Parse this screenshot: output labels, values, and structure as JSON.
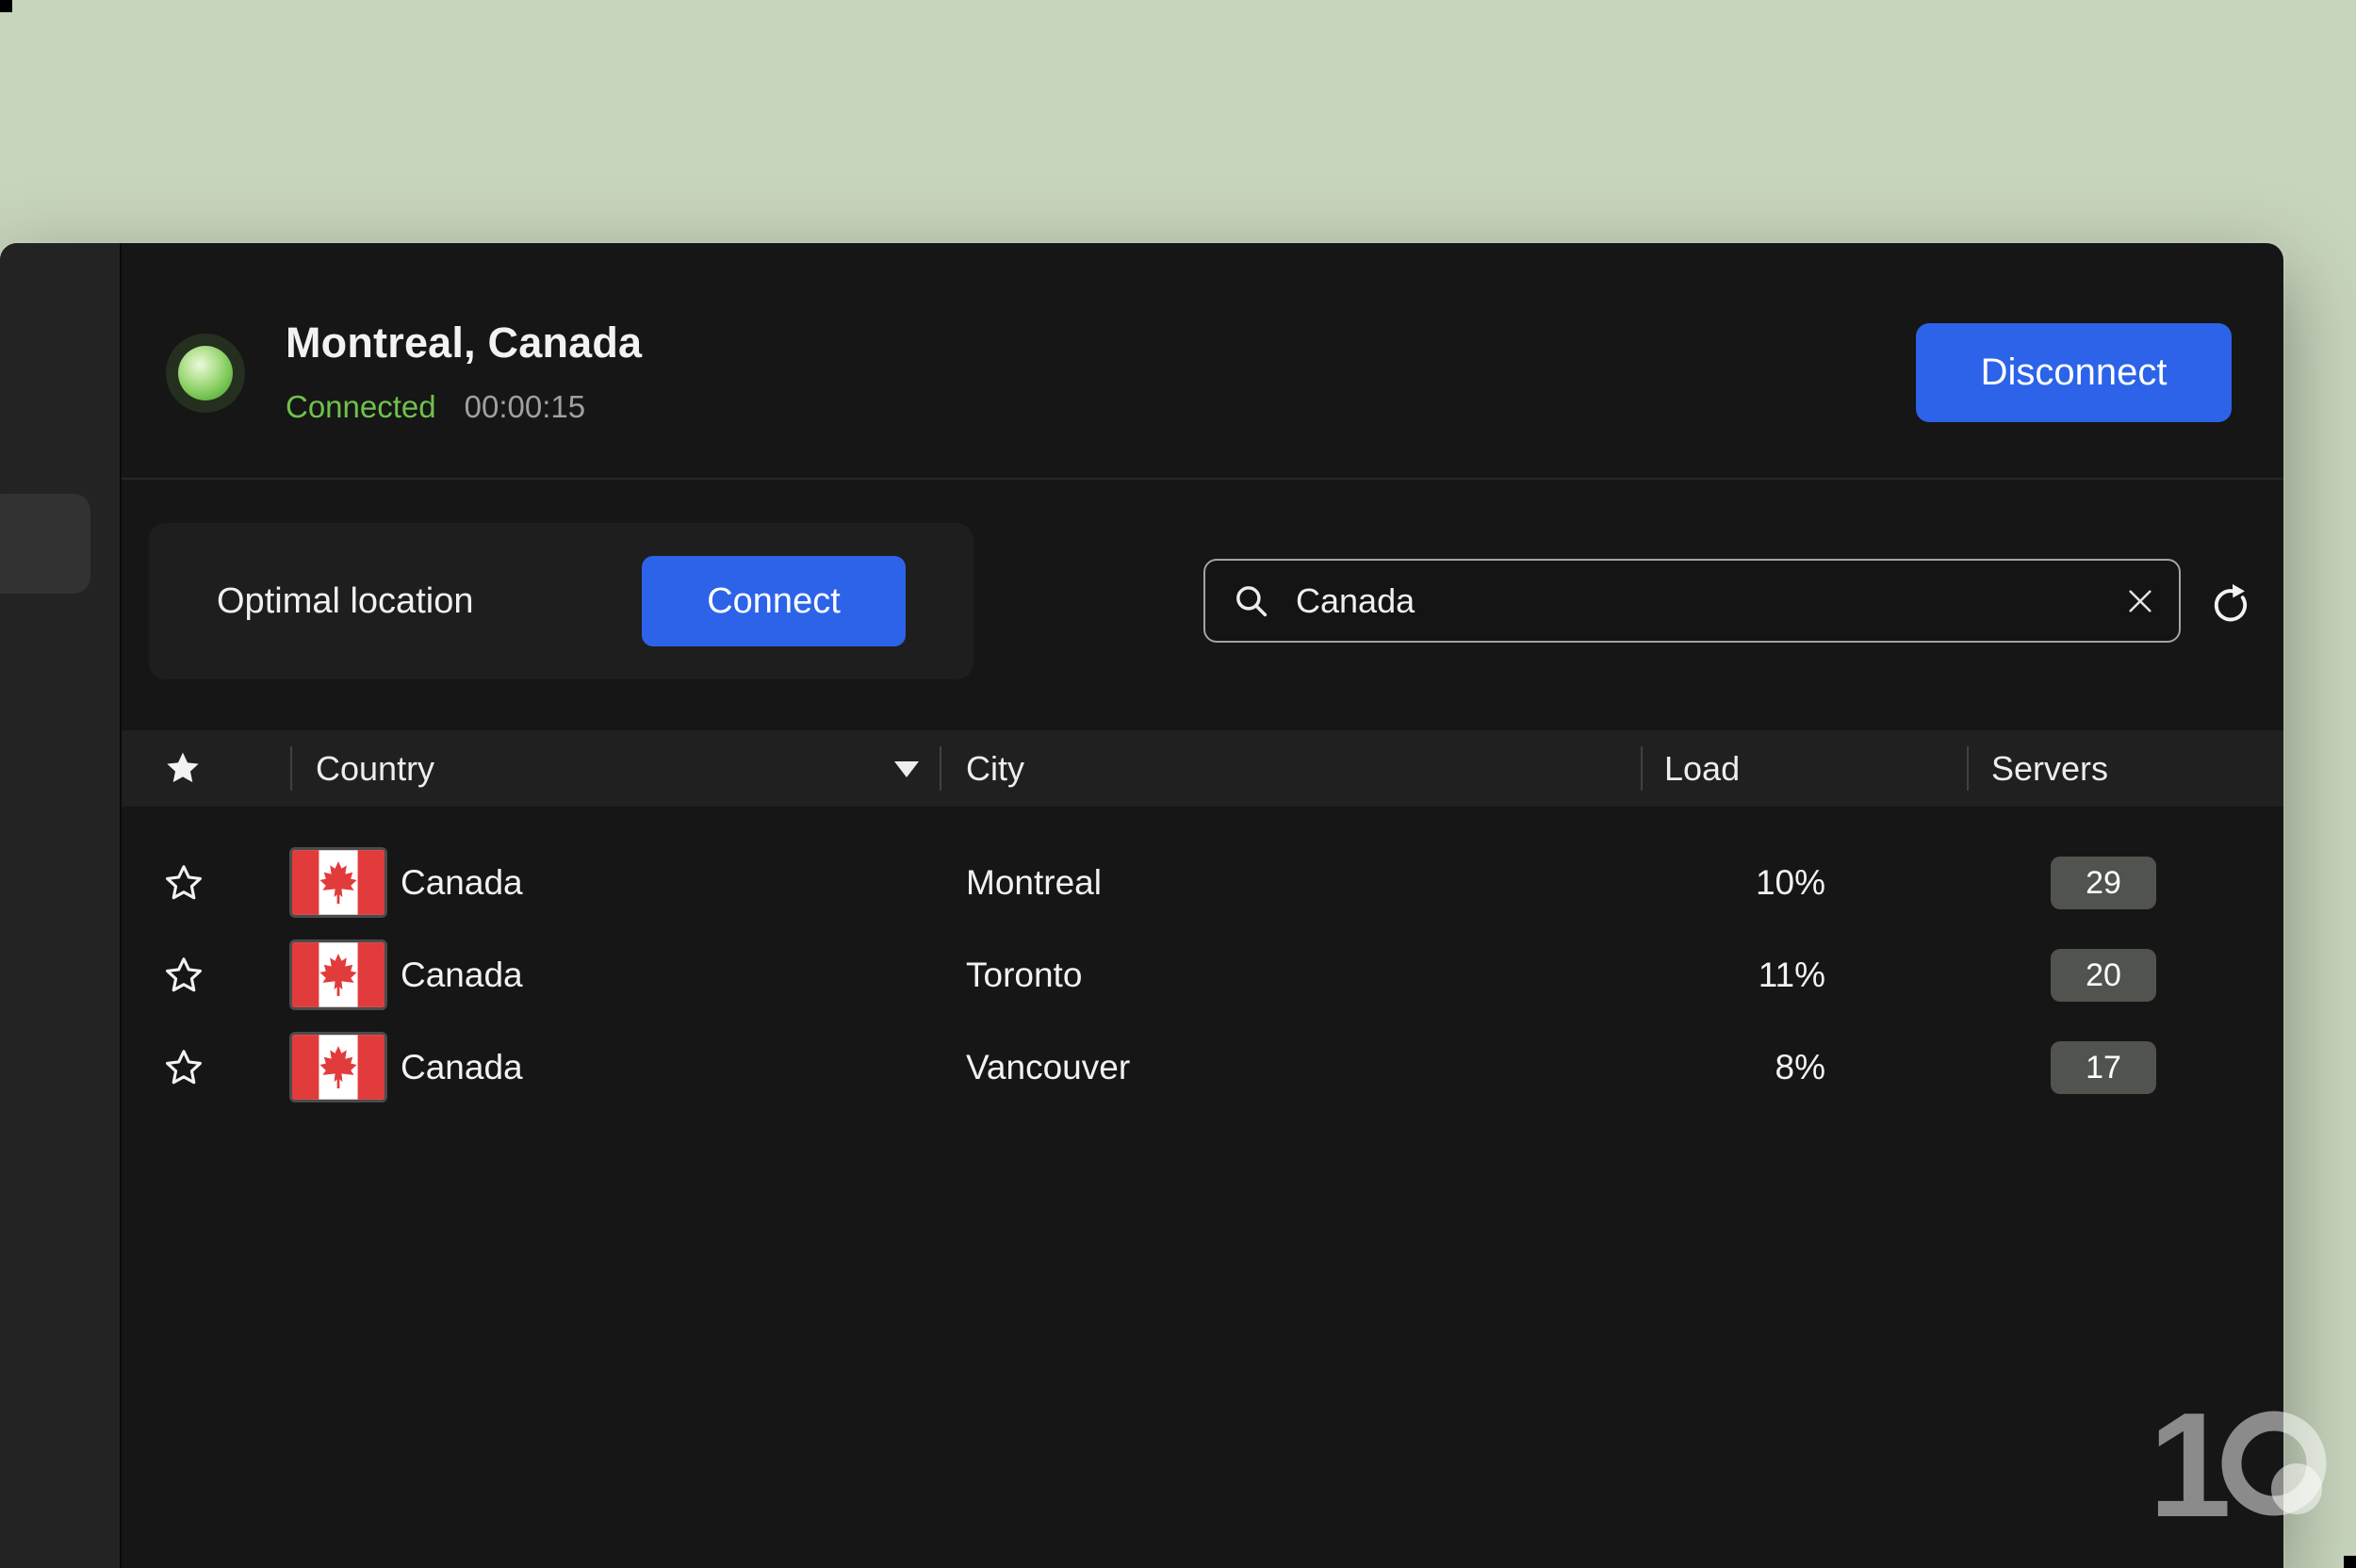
{
  "status": {
    "location": "Montreal, Canada",
    "state": "Connected",
    "timer": "00:00:15",
    "disconnect_label": "Disconnect"
  },
  "quick_connect": {
    "label": "Optimal location",
    "connect_label": "Connect"
  },
  "search": {
    "value": "Canada"
  },
  "table": {
    "headers": {
      "country": "Country",
      "city": "City",
      "load": "Load",
      "servers": "Servers"
    },
    "rows": [
      {
        "country": "Canada",
        "city": "Montreal",
        "load": "10%",
        "servers": "29"
      },
      {
        "country": "Canada",
        "city": "Toronto",
        "load": "11%",
        "servers": "20"
      },
      {
        "country": "Canada",
        "city": "Vancouver",
        "load": "8%",
        "servers": "17"
      }
    ]
  },
  "branding": {
    "watermark": "10",
    "watermark_numeral": "1"
  },
  "colors": {
    "desktop_background": "#c8d5bd",
    "window_background": "#161616",
    "accent_blue": "#2c63e9",
    "connected_green": "#6fc14d",
    "flag_red": "#e23b3b",
    "badge_background": "#50534e",
    "search_border": "#a3a3a3"
  }
}
